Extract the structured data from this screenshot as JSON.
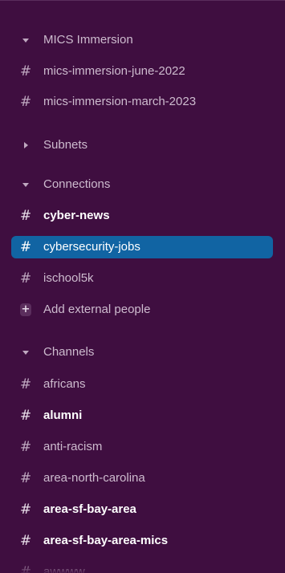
{
  "sections": [
    {
      "label": "MICS Immersion",
      "expanded": true,
      "channels": [
        {
          "name": "mics-immersion-june-2022",
          "unread": false,
          "active": false
        },
        {
          "name": "mics-immersion-march-2023",
          "unread": false,
          "active": false
        }
      ]
    },
    {
      "label": "Subnets",
      "expanded": false,
      "channels": []
    },
    {
      "label": "Connections",
      "expanded": true,
      "channels": [
        {
          "name": "cyber-news",
          "unread": true,
          "active": false
        },
        {
          "name": "cybersecurity-jobs",
          "unread": false,
          "active": true
        },
        {
          "name": "ischool5k",
          "unread": false,
          "active": false
        }
      ],
      "add_label": "Add external people"
    },
    {
      "label": "Channels",
      "expanded": true,
      "channels": [
        {
          "name": "africans",
          "unread": false,
          "active": false
        },
        {
          "name": "alumni",
          "unread": true,
          "active": false
        },
        {
          "name": "anti-racism",
          "unread": false,
          "active": false
        },
        {
          "name": "area-north-carolina",
          "unread": false,
          "active": false
        },
        {
          "name": "area-sf-bay-area",
          "unread": true,
          "active": false
        },
        {
          "name": "area-sf-bay-area-mics",
          "unread": true,
          "active": false
        },
        {
          "name": "awwww",
          "unread": false,
          "active": false
        }
      ]
    }
  ],
  "colors": {
    "sidebar_bg": "#3f0e40",
    "active_bg": "#1164a3",
    "text": "#cdbbce",
    "text_unread": "#ffffff"
  },
  "icons": {
    "channel": "hash-icon",
    "expanded": "caret-down-icon",
    "collapsed": "caret-right-icon",
    "add": "plus-icon"
  }
}
